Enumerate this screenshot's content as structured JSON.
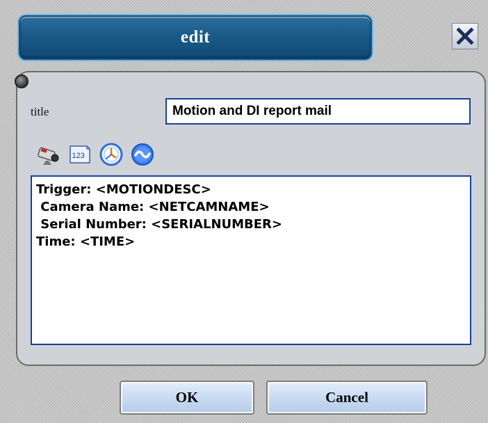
{
  "dialog": {
    "title": "edit",
    "close_icon": "close-x-icon"
  },
  "form": {
    "title_label": "title",
    "title_value": "Motion and DI report mail",
    "toolbar": [
      {
        "icon": "camera-icon"
      },
      {
        "icon": "serial-number-123-icon",
        "text": "123"
      },
      {
        "icon": "clock-time-icon"
      },
      {
        "icon": "wave-icon"
      }
    ],
    "body_lines": [
      "Trigger: <MOTIONDESC>",
      " Camera Name: <NETCAMNAME>",
      " Serial Number: <SERIALNUMBER>",
      "Time: <TIME>"
    ]
  },
  "buttons": {
    "ok_label": "OK",
    "cancel_label": "Cancel"
  },
  "colors": {
    "title_bar": "#1a5a88",
    "input_border": "#1c3f99",
    "button_face": "#c9dbf2"
  }
}
